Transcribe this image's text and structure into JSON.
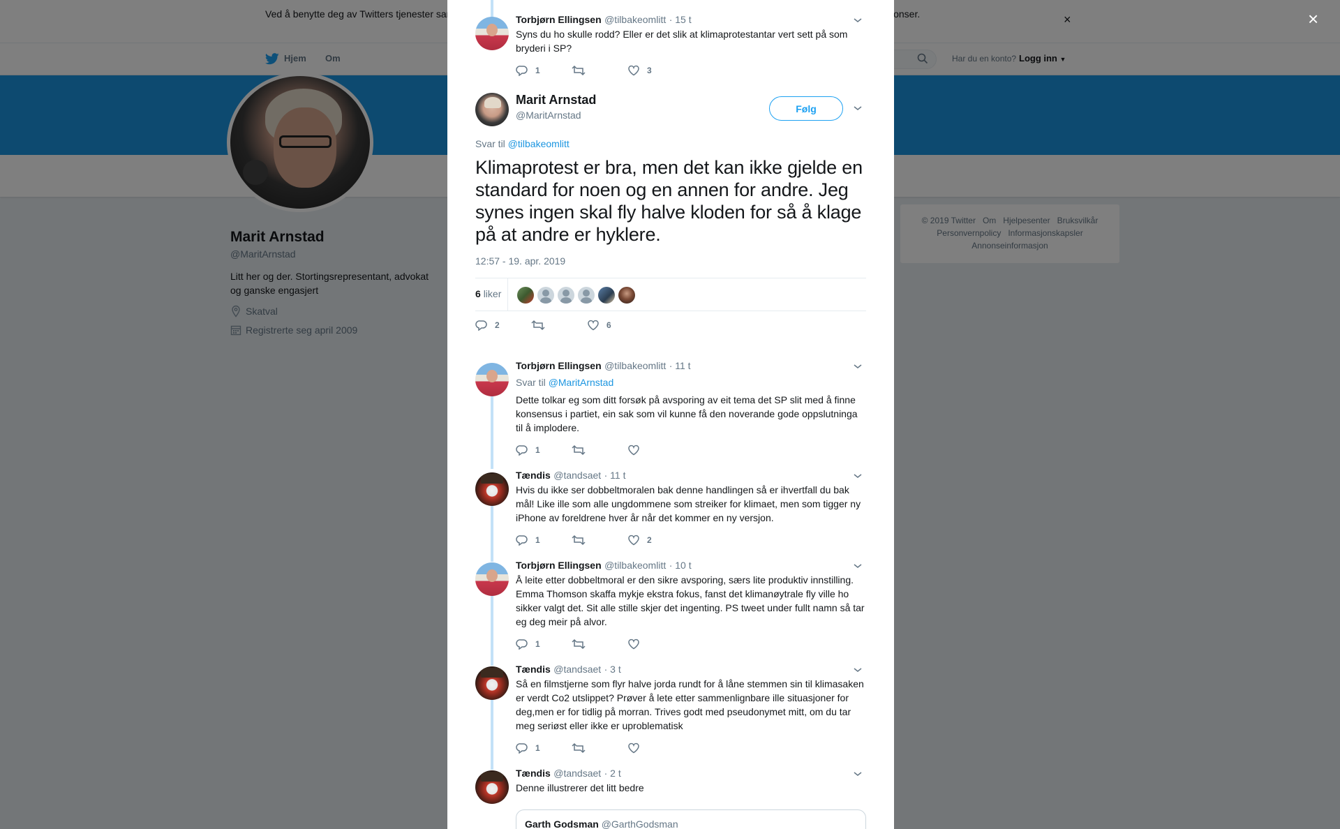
{
  "cookie_bar": {
    "text": "Ved å benytte deg av Twitters tjenester samtykker du til at vi og våre partnere bruker informasjonskapsler til bl.a. analyser, personalisering og annonser.",
    "close": "×"
  },
  "topnav": {
    "home": "Hjem",
    "about": "Om",
    "login_question": "Har du en konto?",
    "login": "Logg inn"
  },
  "profile": {
    "name": "Marit Arnstad",
    "handle": "@MaritArnstad",
    "bio": "Litt her og der. Stortingsrepresentant, advokat og ganske engasjert",
    "location": "Skatval",
    "joined": "Registrerte seg april 2009"
  },
  "footer": {
    "links": [
      "© 2019 Twitter",
      "Om",
      "Hjelpesenter",
      "Bruksvilkår",
      "Personvernpolicy",
      "Informasjonskapsler",
      "Annonseinformasjon"
    ]
  },
  "modal": {
    "close": "×",
    "parent_tweet": {
      "name": "Torbjørn Ellingsen",
      "handle": "@tilbakeomlitt",
      "time": "· 15 t",
      "text": "Syns du ho skulle rodd? Eller er det slik at klimaprotestantar vert sett på som bryderi i SP?",
      "replies": "1",
      "retweets": "",
      "likes": "3"
    },
    "main_tweet": {
      "name": "Marit Arnstad",
      "handle": "@MaritArnstad",
      "follow": "Følg",
      "reply_prefix": "Svar til",
      "reply_to": "@tilbakeomlitt",
      "text": "Klimaprotest er bra, men det kan ikke gjelde en standard for noen og en annen for andre. Jeg synes ingen skal fly halve kloden for så å klage på at andre er hyklere.",
      "timestamp": "12:57 - 19. apr. 2019",
      "likes_count": "6",
      "likes_label": "liker",
      "replies": "2",
      "retweets": "",
      "likes": "6"
    },
    "replies": [
      {
        "name": "Torbjørn Ellingsen",
        "handle": "@tilbakeomlitt",
        "time": "· 11 t",
        "reply_prefix": "Svar til",
        "reply_to": "@MaritArnstad",
        "text": "Dette tolkar eg som ditt forsøk på avsporing av eit tema det SP slit med å finne konsensus i partiet, ein sak som vil kunne få den noverande gode oppslutninga til å implodere.",
        "replies": "1",
        "retweets": "",
        "likes": ""
      },
      {
        "name": "Tændis",
        "handle": "@tandsaet",
        "time": "· 11 t",
        "text": "Hvis du ikke ser dobbeltmoralen bak denne handlingen så er ihvertfall du bak mål! Like ille som alle ungdommene som streiker for klimaet, men som tigger ny iPhone av foreldrene hver år når det kommer en ny versjon.",
        "replies": "1",
        "retweets": "",
        "likes": "2"
      },
      {
        "name": "Torbjørn Ellingsen",
        "handle": "@tilbakeomlitt",
        "time": "· 10 t",
        "text": "Å leite etter dobbeltmoral er den sikre avsporing, særs lite produktiv innstilling. Emma Thomson skaffa mykje ekstra fokus, fanst det klimanøytrale fly ville ho sikker valgt det. Sit alle stille skjer det ingenting. PS tweet under fullt namn så tar eg deg meir på alvor.",
        "replies": "1",
        "retweets": "",
        "likes": ""
      },
      {
        "name": "Tændis",
        "handle": "@tandsaet",
        "time": "· 3 t",
        "text": "Så en filmstjerne som flyr halve jorda rundt for å låne stemmen sin til klimasaken er verdt Co2 utslippet? Prøver å lete etter sammenlignbare ille situasjoner for deg,men er for tidlig på morran. Trives godt med pseudonymet mitt, om du tar meg seriøst eller ikke er uproblematisk",
        "replies": "1",
        "retweets": "",
        "likes": ""
      },
      {
        "name": "Tændis",
        "handle": "@tandsaet",
        "time": "· 2 t",
        "text": "Denne illustrerer det litt bedre",
        "quote_name": "Garth Godsman",
        "quote_handle": "@GarthGodsman"
      }
    ]
  },
  "colors": {
    "brand": "#1da1f2",
    "banner": "#1b95e0",
    "muted": "#657786",
    "thread_line": "#c3e1f7"
  }
}
